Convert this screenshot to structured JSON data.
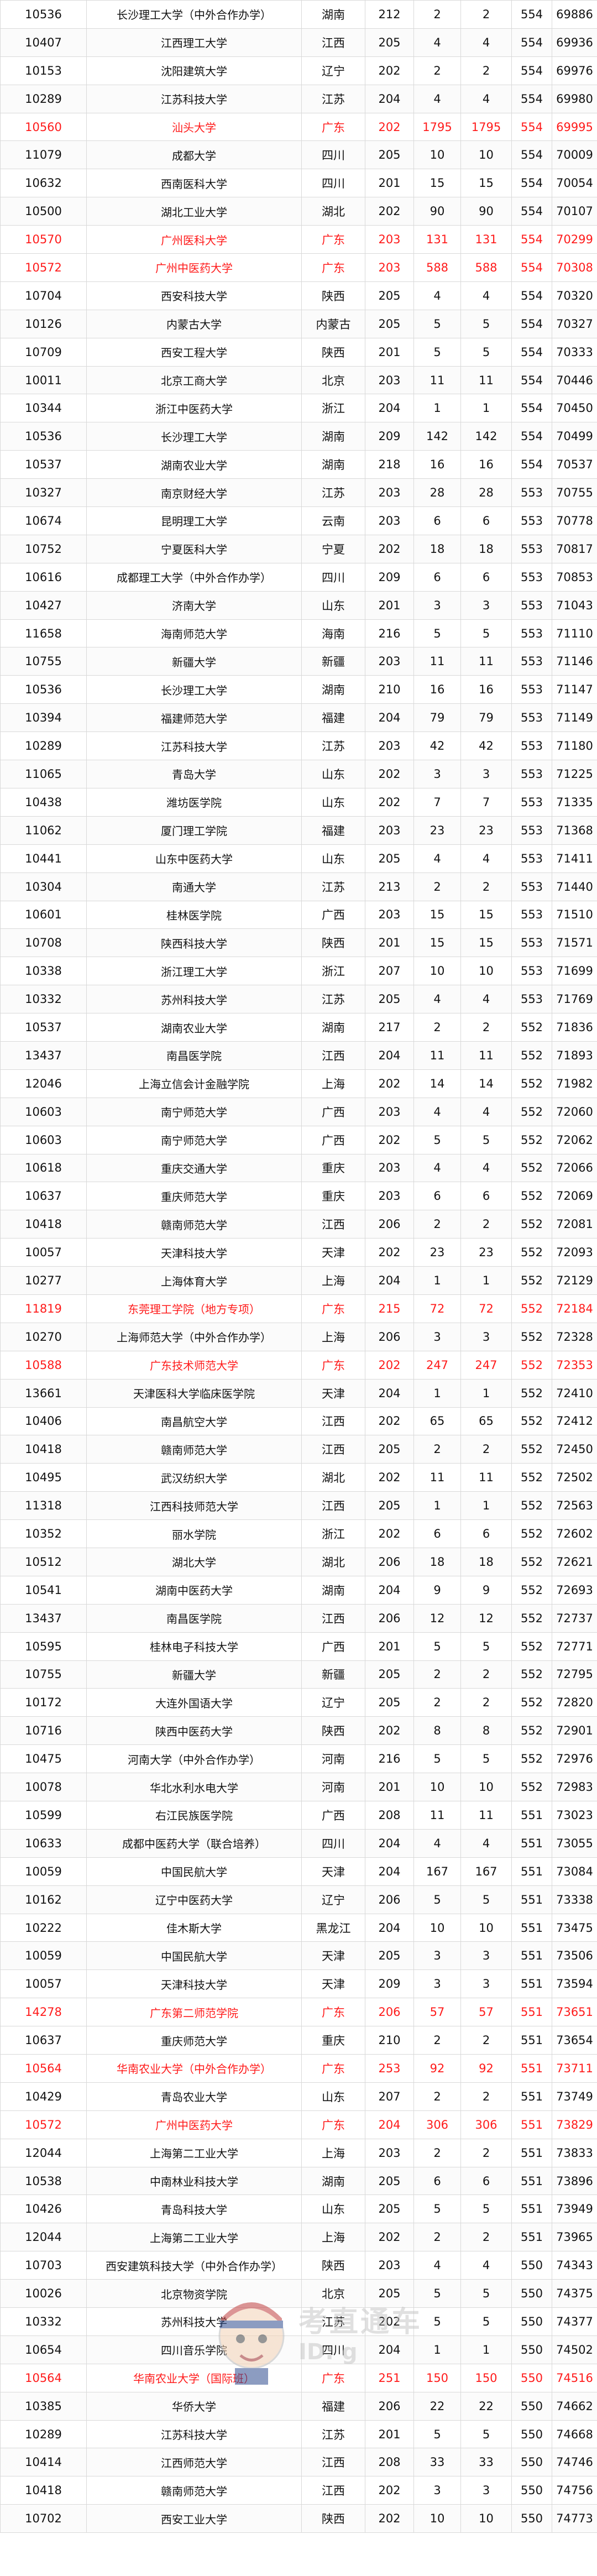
{
  "rows": [
    [
      "10536",
      "长沙理工大学（中外合作办学）",
      "湖南",
      "212",
      "2",
      "2",
      "554",
      "69886",
      false
    ],
    [
      "10407",
      "江西理工大学",
      "江西",
      "205",
      "4",
      "4",
      "554",
      "69936",
      false
    ],
    [
      "10153",
      "沈阳建筑大学",
      "辽宁",
      "202",
      "2",
      "2",
      "554",
      "69976",
      false
    ],
    [
      "10289",
      "江苏科技大学",
      "江苏",
      "204",
      "4",
      "4",
      "554",
      "69980",
      false
    ],
    [
      "10560",
      "汕头大学",
      "广东",
      "202",
      "1795",
      "1795",
      "554",
      "69995",
      true
    ],
    [
      "11079",
      "成都大学",
      "四川",
      "205",
      "10",
      "10",
      "554",
      "70009",
      false
    ],
    [
      "10632",
      "西南医科大学",
      "四川",
      "201",
      "15",
      "15",
      "554",
      "70054",
      false
    ],
    [
      "10500",
      "湖北工业大学",
      "湖北",
      "202",
      "90",
      "90",
      "554",
      "70107",
      false
    ],
    [
      "10570",
      "广州医科大学",
      "广东",
      "203",
      "131",
      "131",
      "554",
      "70299",
      true
    ],
    [
      "10572",
      "广州中医药大学",
      "广东",
      "203",
      "588",
      "588",
      "554",
      "70308",
      true
    ],
    [
      "10704",
      "西安科技大学",
      "陕西",
      "205",
      "4",
      "4",
      "554",
      "70320",
      false
    ],
    [
      "10126",
      "内蒙古大学",
      "内蒙古",
      "205",
      "5",
      "5",
      "554",
      "70327",
      false
    ],
    [
      "10709",
      "西安工程大学",
      "陕西",
      "201",
      "5",
      "5",
      "554",
      "70333",
      false
    ],
    [
      "10011",
      "北京工商大学",
      "北京",
      "203",
      "11",
      "11",
      "554",
      "70446",
      false
    ],
    [
      "10344",
      "浙江中医药大学",
      "浙江",
      "204",
      "1",
      "1",
      "554",
      "70450",
      false
    ],
    [
      "10536",
      "长沙理工大学",
      "湖南",
      "209",
      "142",
      "142",
      "554",
      "70499",
      false
    ],
    [
      "10537",
      "湖南农业大学",
      "湖南",
      "218",
      "16",
      "16",
      "554",
      "70537",
      false
    ],
    [
      "10327",
      "南京财经大学",
      "江苏",
      "203",
      "28",
      "28",
      "553",
      "70755",
      false
    ],
    [
      "10674",
      "昆明理工大学",
      "云南",
      "203",
      "6",
      "6",
      "553",
      "70778",
      false
    ],
    [
      "10752",
      "宁夏医科大学",
      "宁夏",
      "202",
      "18",
      "18",
      "553",
      "70817",
      false
    ],
    [
      "10616",
      "成都理工大学（中外合作办学）",
      "四川",
      "209",
      "6",
      "6",
      "553",
      "70853",
      false
    ],
    [
      "10427",
      "济南大学",
      "山东",
      "201",
      "3",
      "3",
      "553",
      "71043",
      false
    ],
    [
      "11658",
      "海南师范大学",
      "海南",
      "216",
      "5",
      "5",
      "553",
      "71110",
      false
    ],
    [
      "10755",
      "新疆大学",
      "新疆",
      "203",
      "11",
      "11",
      "553",
      "71146",
      false
    ],
    [
      "10536",
      "长沙理工大学",
      "湖南",
      "210",
      "16",
      "16",
      "553",
      "71147",
      false
    ],
    [
      "10394",
      "福建师范大学",
      "福建",
      "204",
      "79",
      "79",
      "553",
      "71149",
      false
    ],
    [
      "10289",
      "江苏科技大学",
      "江苏",
      "203",
      "42",
      "42",
      "553",
      "71180",
      false
    ],
    [
      "11065",
      "青岛大学",
      "山东",
      "202",
      "3",
      "3",
      "553",
      "71225",
      false
    ],
    [
      "10438",
      "潍坊医学院",
      "山东",
      "202",
      "7",
      "7",
      "553",
      "71335",
      false
    ],
    [
      "11062",
      "厦门理工学院",
      "福建",
      "203",
      "23",
      "23",
      "553",
      "71368",
      false
    ],
    [
      "10441",
      "山东中医药大学",
      "山东",
      "205",
      "4",
      "4",
      "553",
      "71411",
      false
    ],
    [
      "10304",
      "南通大学",
      "江苏",
      "213",
      "2",
      "2",
      "553",
      "71440",
      false
    ],
    [
      "10601",
      "桂林医学院",
      "广西",
      "203",
      "15",
      "15",
      "553",
      "71510",
      false
    ],
    [
      "10708",
      "陕西科技大学",
      "陕西",
      "201",
      "15",
      "15",
      "553",
      "71571",
      false
    ],
    [
      "10338",
      "浙江理工大学",
      "浙江",
      "207",
      "10",
      "10",
      "553",
      "71699",
      false
    ],
    [
      "10332",
      "苏州科技大学",
      "江苏",
      "205",
      "4",
      "4",
      "553",
      "71769",
      false
    ],
    [
      "10537",
      "湖南农业大学",
      "湖南",
      "217",
      "2",
      "2",
      "552",
      "71836",
      false
    ],
    [
      "13437",
      "南昌医学院",
      "江西",
      "204",
      "11",
      "11",
      "552",
      "71893",
      false
    ],
    [
      "12046",
      "上海立信会计金融学院",
      "上海",
      "202",
      "14",
      "14",
      "552",
      "71982",
      false
    ],
    [
      "10603",
      "南宁师范大学",
      "广西",
      "203",
      "4",
      "4",
      "552",
      "72060",
      false
    ],
    [
      "10603",
      "南宁师范大学",
      "广西",
      "202",
      "5",
      "5",
      "552",
      "72062",
      false
    ],
    [
      "10618",
      "重庆交通大学",
      "重庆",
      "203",
      "4",
      "4",
      "552",
      "72066",
      false
    ],
    [
      "10637",
      "重庆师范大学",
      "重庆",
      "203",
      "6",
      "6",
      "552",
      "72069",
      false
    ],
    [
      "10418",
      "赣南师范大学",
      "江西",
      "206",
      "2",
      "2",
      "552",
      "72081",
      false
    ],
    [
      "10057",
      "天津科技大学",
      "天津",
      "202",
      "23",
      "23",
      "552",
      "72093",
      false
    ],
    [
      "10277",
      "上海体育大学",
      "上海",
      "204",
      "1",
      "1",
      "552",
      "72129",
      false
    ],
    [
      "11819",
      "东莞理工学院（地方专项）",
      "广东",
      "215",
      "72",
      "72",
      "552",
      "72184",
      true
    ],
    [
      "10270",
      "上海师范大学（中外合作办学）",
      "上海",
      "206",
      "3",
      "3",
      "552",
      "72328",
      false
    ],
    [
      "10588",
      "广东技术师范大学",
      "广东",
      "202",
      "247",
      "247",
      "552",
      "72353",
      true
    ],
    [
      "13661",
      "天津医科大学临床医学院",
      "天津",
      "204",
      "1",
      "1",
      "552",
      "72410",
      false
    ],
    [
      "10406",
      "南昌航空大学",
      "江西",
      "202",
      "65",
      "65",
      "552",
      "72412",
      false
    ],
    [
      "10418",
      "赣南师范大学",
      "江西",
      "205",
      "2",
      "2",
      "552",
      "72450",
      false
    ],
    [
      "10495",
      "武汉纺织大学",
      "湖北",
      "202",
      "11",
      "11",
      "552",
      "72502",
      false
    ],
    [
      "11318",
      "江西科技师范大学",
      "江西",
      "205",
      "1",
      "1",
      "552",
      "72563",
      false
    ],
    [
      "10352",
      "丽水学院",
      "浙江",
      "202",
      "6",
      "6",
      "552",
      "72602",
      false
    ],
    [
      "10512",
      "湖北大学",
      "湖北",
      "206",
      "18",
      "18",
      "552",
      "72621",
      false
    ],
    [
      "10541",
      "湖南中医药大学",
      "湖南",
      "204",
      "9",
      "9",
      "552",
      "72693",
      false
    ],
    [
      "13437",
      "南昌医学院",
      "江西",
      "206",
      "12",
      "12",
      "552",
      "72737",
      false
    ],
    [
      "10595",
      "桂林电子科技大学",
      "广西",
      "201",
      "5",
      "5",
      "552",
      "72771",
      false
    ],
    [
      "10755",
      "新疆大学",
      "新疆",
      "205",
      "2",
      "2",
      "552",
      "72795",
      false
    ],
    [
      "10172",
      "大连外国语大学",
      "辽宁",
      "205",
      "2",
      "2",
      "552",
      "72820",
      false
    ],
    [
      "10716",
      "陕西中医药大学",
      "陕西",
      "202",
      "8",
      "8",
      "552",
      "72901",
      false
    ],
    [
      "10475",
      "河南大学（中外合作办学）",
      "河南",
      "216",
      "5",
      "5",
      "552",
      "72976",
      false
    ],
    [
      "10078",
      "华北水利水电大学",
      "河南",
      "201",
      "10",
      "10",
      "552",
      "72983",
      false
    ],
    [
      "10599",
      "右江民族医学院",
      "广西",
      "208",
      "11",
      "11",
      "551",
      "73023",
      false
    ],
    [
      "10633",
      "成都中医药大学（联合培养）",
      "四川",
      "204",
      "4",
      "4",
      "551",
      "73055",
      false
    ],
    [
      "10059",
      "中国民航大学",
      "天津",
      "204",
      "167",
      "167",
      "551",
      "73084",
      false
    ],
    [
      "10162",
      "辽宁中医药大学",
      "辽宁",
      "206",
      "5",
      "5",
      "551",
      "73338",
      false
    ],
    [
      "10222",
      "佳木斯大学",
      "黑龙江",
      "204",
      "10",
      "10",
      "551",
      "73475",
      false
    ],
    [
      "10059",
      "中国民航大学",
      "天津",
      "205",
      "3",
      "3",
      "551",
      "73506",
      false
    ],
    [
      "10057",
      "天津科技大学",
      "天津",
      "209",
      "3",
      "3",
      "551",
      "73594",
      false
    ],
    [
      "14278",
      "广东第二师范学院",
      "广东",
      "206",
      "57",
      "57",
      "551",
      "73651",
      true
    ],
    [
      "10637",
      "重庆师范大学",
      "重庆",
      "210",
      "2",
      "2",
      "551",
      "73654",
      false
    ],
    [
      "10564",
      "华南农业大学（中外合作办学）",
      "广东",
      "253",
      "92",
      "92",
      "551",
      "73711",
      true
    ],
    [
      "10429",
      "青岛农业大学",
      "山东",
      "207",
      "2",
      "2",
      "551",
      "73749",
      false
    ],
    [
      "10572",
      "广州中医药大学",
      "广东",
      "204",
      "306",
      "306",
      "551",
      "73829",
      true
    ],
    [
      "12044",
      "上海第二工业大学",
      "上海",
      "203",
      "2",
      "2",
      "551",
      "73833",
      false
    ],
    [
      "10538",
      "中南林业科技大学",
      "湖南",
      "205",
      "6",
      "6",
      "551",
      "73896",
      false
    ],
    [
      "10426",
      "青岛科技大学",
      "山东",
      "205",
      "5",
      "5",
      "551",
      "73949",
      false
    ],
    [
      "12044",
      "上海第二工业大学",
      "上海",
      "202",
      "2",
      "2",
      "551",
      "73965",
      false
    ],
    [
      "10703",
      "西安建筑科技大学（中外合作办学）",
      "陕西",
      "203",
      "4",
      "4",
      "550",
      "74343",
      false
    ],
    [
      "10026",
      "北京物资学院",
      "北京",
      "205",
      "5",
      "5",
      "550",
      "74375",
      false
    ],
    [
      "10332",
      "苏州科技大学",
      "江苏",
      "202",
      "5",
      "5",
      "550",
      "74377",
      false
    ],
    [
      "10654",
      "四川音乐学院",
      "四川",
      "204",
      "1",
      "1",
      "550",
      "74502",
      false
    ],
    [
      "10564",
      "华南农业大学（国际班）",
      "广东",
      "251",
      "150",
      "150",
      "550",
      "74516",
      true
    ],
    [
      "10385",
      "华侨大学",
      "福建",
      "206",
      "22",
      "22",
      "550",
      "74662",
      false
    ],
    [
      "10289",
      "江苏科技大学",
      "江苏",
      "201",
      "5",
      "5",
      "550",
      "74668",
      false
    ],
    [
      "10414",
      "江西师范大学",
      "江西",
      "208",
      "33",
      "33",
      "550",
      "74746",
      false
    ],
    [
      "10418",
      "赣南师范大学",
      "江西",
      "202",
      "3",
      "3",
      "550",
      "74756",
      false
    ],
    [
      "10702",
      "西安工业大学",
      "陕西",
      "202",
      "10",
      "10",
      "550",
      "74773",
      false
    ]
  ],
  "watermark": {
    "line1": "考直通车",
    "line2": "ID: g"
  },
  "colors": {
    "highlight": "#ff1a1a",
    "text": "#111111",
    "grid": "#d9d9d9"
  }
}
